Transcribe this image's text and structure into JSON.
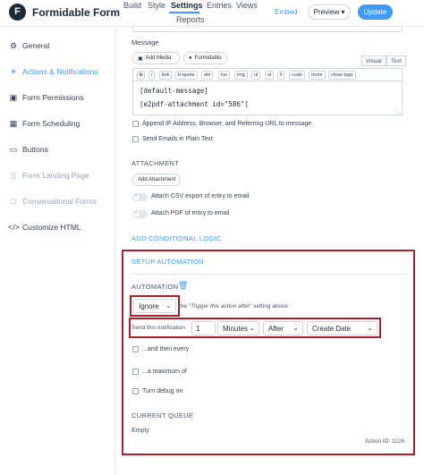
{
  "header": {
    "logo": "F",
    "title": "Formidable Form",
    "nav": {
      "build": "Build",
      "style": "Style",
      "settings": "Settings",
      "entries": "Entries",
      "views": "Views",
      "reports": "Reports"
    },
    "embed": "Embed",
    "preview": "Preview",
    "update": "Update"
  },
  "sidebar": {
    "items": [
      {
        "label": "General",
        "icon": "gear-icon"
      },
      {
        "label": "Actions & Notifications",
        "icon": "megaphone-icon",
        "active": true
      },
      {
        "label": "Form Permissions",
        "icon": "lock-icon"
      },
      {
        "label": "Form Scheduling",
        "icon": "calendar-icon"
      },
      {
        "label": "Buttons",
        "icon": "button-icon"
      },
      {
        "label": "Form Landing Page",
        "icon": "file-icon",
        "muted": true
      },
      {
        "label": "Conversational Forms",
        "icon": "chat-icon",
        "muted": true
      },
      {
        "label": "Customize HTML",
        "icon": "code-icon"
      }
    ]
  },
  "message": {
    "label": "Message",
    "add_media": "Add Media",
    "formidable": "Formidable",
    "tab_visual": "Visual",
    "tab_text": "Text",
    "toolbar": [
      "b",
      "i",
      "link",
      "b-quote",
      "del",
      "ins",
      "img",
      "ul",
      "ol",
      "li",
      "code",
      "more",
      "close tags"
    ],
    "lines": [
      "[default-message]",
      "[e2pdf-attachment id=\"586\"]"
    ]
  },
  "options": {
    "append_ip": "Append IP Address, Browser, and Referring URL to message",
    "plain_text": "Send Emails in Plain Text"
  },
  "attachment": {
    "heading": "ATTACHMENT",
    "add_button": "Add Attachment",
    "csv": "Attach CSV export of entry to email",
    "pdf": "Attach PDF of entry to email"
  },
  "conditional_logic": "ADD CONDITIONAL LOGIC",
  "automation": {
    "setup": "SETUP AUTOMATION",
    "heading": "AUTOMATION",
    "mode": "Ignore",
    "hint_prefix": "the \"",
    "hint_em": "Trigger this action after",
    "hint_suffix": "\" setting above",
    "send_label": "Send this notification",
    "amount": "1",
    "unit": "Minutes",
    "relation": "After",
    "field": "Create Date",
    "then_every": "...and then every",
    "maximum": "...a maximum of",
    "debug": "Turn debug on",
    "queue_heading": "CURRENT QUEUE",
    "queue_status": "Empty",
    "action_id": "Action ID: 1126"
  },
  "colors": {
    "accent": "#4199fd",
    "highlight_border": "#b01c28"
  }
}
